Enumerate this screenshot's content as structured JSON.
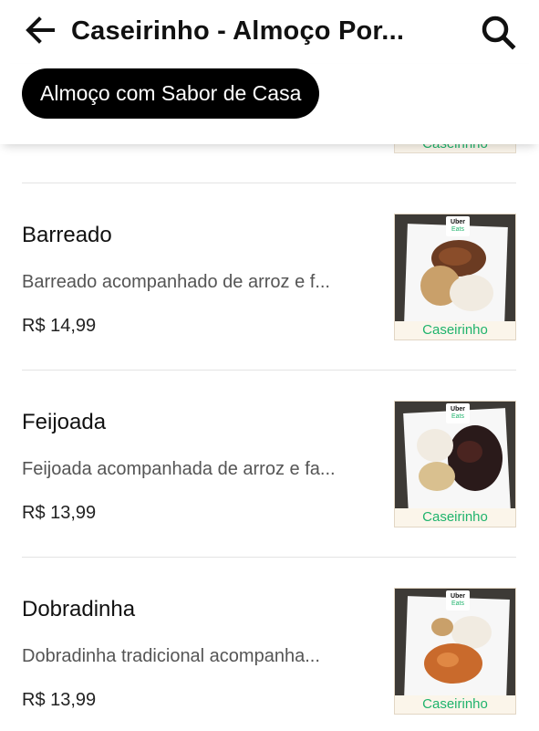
{
  "header": {
    "back_icon": "arrow-left-icon",
    "title": "Caseirinho - Almoço Por...",
    "search_icon": "search-icon"
  },
  "category_chip": {
    "label": "Almoço com Sabor de Casa"
  },
  "partial_item": {
    "thumbnail_brand": "Caseirinho"
  },
  "menu_items": [
    {
      "name": "Barreado",
      "description": "Barreado acompanhado de arroz e f...",
      "price": "R$ 14,99",
      "thumbnail": {
        "brand": "Caseirinho",
        "badge_top": "Uber",
        "badge_bottom": "Eats"
      }
    },
    {
      "name": "Feijoada",
      "description": "Feijoada acompanhada de arroz e fa...",
      "price": "R$ 13,99",
      "thumbnail": {
        "brand": "Caseirinho",
        "badge_top": "Uber",
        "badge_bottom": "Eats"
      }
    },
    {
      "name": "Dobradinha",
      "description": "Dobradinha tradicional acompanha...",
      "price": "R$ 13,99",
      "thumbnail": {
        "brand": "Caseirinho",
        "badge_top": "Uber",
        "badge_bottom": "Eats"
      }
    }
  ],
  "colors": {
    "chip_background": "#000000",
    "brand_green": "#1fb36c",
    "divider": "#e4e4e4"
  }
}
